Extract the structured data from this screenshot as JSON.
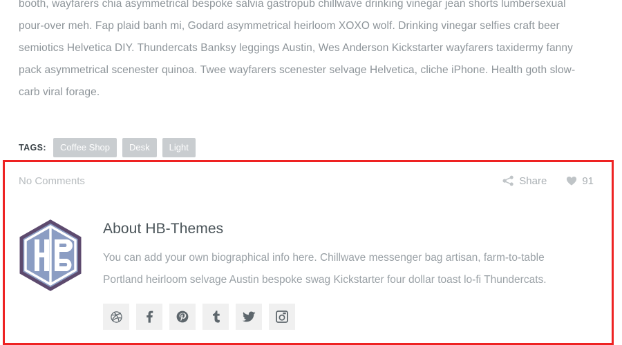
{
  "article": {
    "paragraphs": [
      "booth, wayfarers chia asymmetrical bespoke salvia gastropub chillwave drinking vinegar jean shorts lumbersexual pour-over meh. Fap plaid banh mi, Godard asymmetrical heirloom XOXO wolf. Drinking vinegar selfies craft beer semiotics Helvetica DIY. Thundercats Banksy leggings Austin, Wes Anderson Kickstarter wayfarers taxidermy fanny pack asymmetrical scenester quinoa. Twee wayfarers scenester selvage Helvetica, cliche iPhone. Health goth slow-carb viral forage."
    ]
  },
  "tags": {
    "label": "TAGS:",
    "items": [
      "Coffee Shop",
      "Desk",
      "Light"
    ]
  },
  "meta": {
    "comments_text": "No Comments",
    "share_label": "Share",
    "share_icon": "share-icon",
    "like_count": "91",
    "like_icon": "heart-icon"
  },
  "author": {
    "avatar_icon": "hb-themes-hexagon-logo",
    "avatar_letters": "HB",
    "title": "About HB-Themes",
    "bio": "You can add your own biographical info here. Chillwave messenger bag artisan, farm-to-table Portland heirloom selvage Austin bespoke swag Kickstarter four dollar toast lo-fi Thundercats.",
    "social": [
      {
        "name": "dribbble",
        "label": "Dribbble"
      },
      {
        "name": "facebook",
        "label": "Facebook"
      },
      {
        "name": "pinterest",
        "label": "Pinterest"
      },
      {
        "name": "tumblr",
        "label": "Tumblr"
      },
      {
        "name": "twitter",
        "label": "Twitter"
      },
      {
        "name": "instagram",
        "label": "Instagram"
      }
    ]
  },
  "colors": {
    "highlight_border": "#ee2222",
    "tag_chip_bg": "#c9cdd0",
    "body_text": "#8d9499",
    "heading": "#4a5459",
    "meta_text": "#a9afb3",
    "social_bg": "#f0f0f0",
    "logo_outline": "#5d4a6e",
    "logo_fill": "#8b9dc3"
  }
}
